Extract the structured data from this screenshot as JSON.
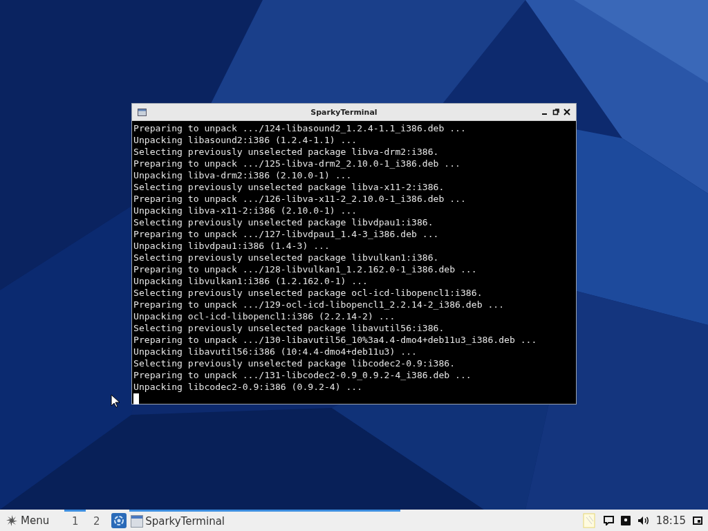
{
  "window": {
    "title": "SparkyTerminal",
    "lines": [
      "Preparing to unpack .../124-libasound2_1.2.4-1.1_i386.deb ...",
      "Unpacking libasound2:i386 (1.2.4-1.1) ...",
      "Selecting previously unselected package libva-drm2:i386.",
      "Preparing to unpack .../125-libva-drm2_2.10.0-1_i386.deb ...",
      "Unpacking libva-drm2:i386 (2.10.0-1) ...",
      "Selecting previously unselected package libva-x11-2:i386.",
      "Preparing to unpack .../126-libva-x11-2_2.10.0-1_i386.deb ...",
      "Unpacking libva-x11-2:i386 (2.10.0-1) ...",
      "Selecting previously unselected package libvdpau1:i386.",
      "Preparing to unpack .../127-libvdpau1_1.4-3_i386.deb ...",
      "Unpacking libvdpau1:i386 (1.4-3) ...",
      "Selecting previously unselected package libvulkan1:i386.",
      "Preparing to unpack .../128-libvulkan1_1.2.162.0-1_i386.deb ...",
      "Unpacking libvulkan1:i386 (1.2.162.0-1) ...",
      "Selecting previously unselected package ocl-icd-libopencl1:i386.",
      "Preparing to unpack .../129-ocl-icd-libopencl1_2.2.14-2_i386.deb ...",
      "Unpacking ocl-icd-libopencl1:i386 (2.2.14-2) ...",
      "Selecting previously unselected package libavutil56:i386.",
      "Preparing to unpack .../130-libavutil56_10%3a4.4-dmo4+deb11u3_i386.deb ...",
      "Unpacking libavutil56:i386 (10:4.4-dmo4+deb11u3) ...",
      "Selecting previously unselected package libcodec2-0.9:i386.",
      "Preparing to unpack .../131-libcodec2-0.9_0.9.2-4_i386.deb ...",
      "Unpacking libcodec2-0.9:i386 (0.9.2-4) ..."
    ]
  },
  "taskbar": {
    "menu": "Menu",
    "workspaces": [
      {
        "label": "1",
        "selected": true
      },
      {
        "label": "2",
        "selected": false
      }
    ],
    "tasks": [
      {
        "label": "SparkyTerminal",
        "selected": true
      }
    ],
    "clock": "18:15"
  }
}
